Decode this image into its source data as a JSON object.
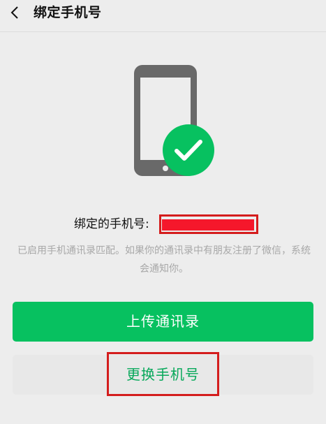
{
  "header": {
    "title": "绑定手机号",
    "back_icon": "chevron-left-icon"
  },
  "illustration": {
    "phone_icon": "smartphone-icon",
    "check_icon": "checkmark-icon",
    "phone_color": "#696969",
    "check_color": "#07c160"
  },
  "binding": {
    "label": "绑定的手机号:",
    "redaction_color": "#f5172b",
    "highlight_color": "#d41d1d"
  },
  "info": {
    "text": "已启用手机通讯录匹配。如果你的通讯录中有朋友注册了微信，系统会通知你。"
  },
  "actions": {
    "upload_contacts_label": "上传通讯录",
    "change_phone_label": "更换手机号",
    "primary_color": "#07c160"
  }
}
